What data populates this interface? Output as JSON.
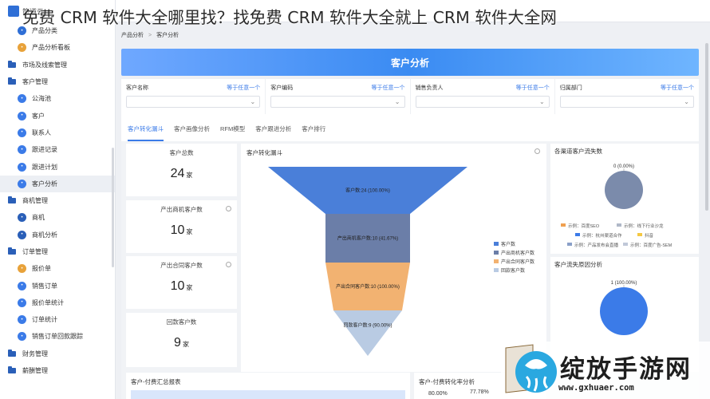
{
  "overlay_title": "免费 CRM 软件大全哪里找？找免费 CRM 软件大全就上 CRM 软件大全网",
  "app": {
    "brand": "简道云"
  },
  "breadcrumb": [
    "产品分析",
    "客户分析"
  ],
  "sidebar": {
    "items": [
      {
        "label": "产品分类",
        "kind": "sub",
        "icon": "product-category-icon",
        "color": "#2f6fd6"
      },
      {
        "label": "产品分析看板",
        "kind": "sub",
        "icon": "product-dashboard-icon",
        "color": "#e8a23a"
      },
      {
        "label": "市场及线索管理",
        "kind": "group",
        "icon": "folder-icon"
      },
      {
        "label": "客户管理",
        "kind": "group",
        "icon": "folder-icon"
      },
      {
        "label": "公海池",
        "kind": "sub",
        "icon": "sea-pool-icon",
        "color": "#3b7be8"
      },
      {
        "label": "客户",
        "kind": "sub",
        "icon": "customer-icon",
        "color": "#3b7be8"
      },
      {
        "label": "联系人",
        "kind": "sub",
        "icon": "contact-icon",
        "color": "#3b7be8"
      },
      {
        "label": "跟进记录",
        "kind": "sub",
        "icon": "followup-record-icon",
        "color": "#3b7be8"
      },
      {
        "label": "跟进计划",
        "kind": "sub",
        "icon": "followup-plan-icon",
        "color": "#3b7be8"
      },
      {
        "label": "客户分析",
        "kind": "sub",
        "icon": "customer-analysis-icon",
        "color": "#3b7be8",
        "active": true
      },
      {
        "label": "商机管理",
        "kind": "group",
        "icon": "folder-icon"
      },
      {
        "label": "商机",
        "kind": "sub",
        "icon": "opportunity-icon",
        "color": "#2a5fb8"
      },
      {
        "label": "商机分析",
        "kind": "sub",
        "icon": "opportunity-analysis-icon",
        "color": "#2a5fb8"
      },
      {
        "label": "订单管理",
        "kind": "group",
        "icon": "folder-icon"
      },
      {
        "label": "报价单",
        "kind": "sub",
        "icon": "quote-icon",
        "color": "#e8a23a"
      },
      {
        "label": "销售订单",
        "kind": "sub",
        "icon": "sales-order-icon",
        "color": "#3b7be8"
      },
      {
        "label": "报价单统计",
        "kind": "sub",
        "icon": "quote-stats-icon",
        "color": "#3b7be8"
      },
      {
        "label": "订单统计",
        "kind": "sub",
        "icon": "order-stats-icon",
        "color": "#3b7be8"
      },
      {
        "label": "销售订单回款跟踪",
        "kind": "sub",
        "icon": "payment-tracking-icon",
        "color": "#3b7be8"
      },
      {
        "label": "财务管理",
        "kind": "group",
        "icon": "folder-icon"
      },
      {
        "label": "薪酬管理",
        "kind": "group",
        "icon": "folder-icon"
      }
    ]
  },
  "page": {
    "title": "客户分析"
  },
  "filters": [
    {
      "label": "客户名称",
      "link": "等于任意一个"
    },
    {
      "label": "客户编码",
      "link": "等于任意一个"
    },
    {
      "label": "销售负责人",
      "link": "等于任意一个"
    },
    {
      "label": "归属部门",
      "link": "等于任意一个"
    }
  ],
  "tabs": [
    "客户转化漏斗",
    "客户画像分析",
    "RFM模型",
    "客户跟进分析",
    "客户排行"
  ],
  "kpis": [
    {
      "label": "客户总数",
      "value": "24",
      "unit": "家"
    },
    {
      "label": "产出商机客户数",
      "value": "10",
      "unit": "家"
    },
    {
      "label": "产出合同客户数",
      "value": "10",
      "unit": "家"
    },
    {
      "label": "回款客户数",
      "value": "9",
      "unit": "家"
    }
  ],
  "funnel_panel": {
    "title": "客户转化漏斗"
  },
  "chart_data": [
    {
      "type": "funnel",
      "title": "客户转化漏斗",
      "stages": [
        {
          "name": "客户数",
          "value": 24,
          "percent": "100.00%",
          "label": "客户数:24 (100.00%)",
          "color": "#4a7fd9"
        },
        {
          "name": "产出商机客户数",
          "value": 10,
          "percent": "41.67%",
          "label": "产出商机客户数:10 (41.67%)",
          "color": "#6b7ea8"
        },
        {
          "name": "产出合同客户数",
          "value": 10,
          "percent": "100.00%",
          "label": "产出合同客户数:10 (100.00%)",
          "color": "#f2b271"
        },
        {
          "name": "回款客户数",
          "value": 9,
          "percent": "90.00%",
          "label": "回款客户数:9 (90.00%)",
          "color": "#b9cbe3"
        }
      ],
      "legend": [
        "客户数",
        "产出商机客户数",
        "产出合同客户数",
        "回款客户数"
      ],
      "legend_placement": "right"
    },
    {
      "type": "pie",
      "title": "各渠道客户流失数",
      "slices": [
        {
          "value": 0,
          "label": "0 (0.00%)",
          "color": "#7b8bab"
        }
      ],
      "legend": [
        {
          "name": "示例：百度SEO",
          "color": "#f0a050"
        },
        {
          "name": "示例：线下行业沙龙",
          "color": "#b0b8c8"
        },
        {
          "name": "示例：杭州渠道合作",
          "color": "#3b7be8"
        },
        {
          "name": "抖音",
          "color": "#f5c842"
        },
        {
          "name": "示例：产品发布会直播",
          "color": "#8aa0c8"
        },
        {
          "name": "示例：百度广告-SEM",
          "color": "#c0c8d8"
        }
      ]
    },
    {
      "type": "pie",
      "title": "客户流失原因分析",
      "slices": [
        {
          "value": 1,
          "label": "1 (100.00%)",
          "color": "#3b7be8"
        }
      ]
    }
  ],
  "bottom": {
    "left_title": "客户-付费汇总报表",
    "right_title": "客户-付费转化率分析",
    "right_values": [
      "80.00%",
      "77.78%"
    ]
  },
  "watermark": {
    "name": "绽放手游网",
    "url": "www.gxhuaer.com"
  }
}
